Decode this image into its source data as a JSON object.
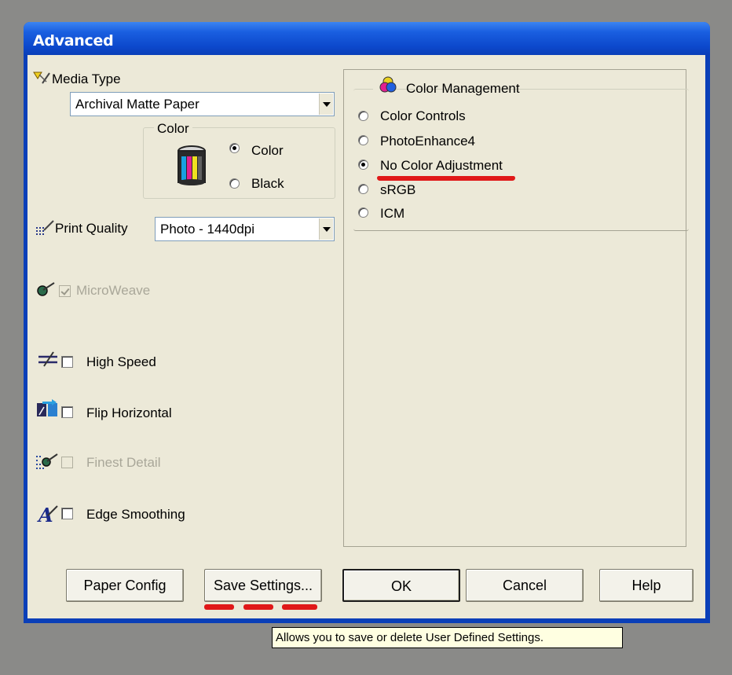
{
  "window": {
    "title": "Advanced"
  },
  "media_type": {
    "label": "Media Type",
    "selected": "Archival Matte Paper"
  },
  "color_group": {
    "label": "Color",
    "options": [
      {
        "label": "Color",
        "checked": true
      },
      {
        "label": "Black",
        "checked": false
      }
    ]
  },
  "print_quality": {
    "label": "Print Quality",
    "selected": "Photo - 1440dpi"
  },
  "options": {
    "microweave": {
      "label": "MicroWeave",
      "checked": true,
      "enabled": false
    },
    "high_speed": {
      "label": "High Speed",
      "checked": false,
      "enabled": true
    },
    "flip_horizontal": {
      "label": "Flip Horizontal",
      "checked": false,
      "enabled": true
    },
    "finest_detail": {
      "label": "Finest Detail",
      "checked": false,
      "enabled": false
    },
    "edge_smoothing": {
      "label": "Edge Smoothing",
      "checked": false,
      "enabled": true
    }
  },
  "color_management": {
    "label": "Color Management",
    "options": [
      {
        "label": "Color Controls",
        "checked": false
      },
      {
        "label": "PhotoEnhance4",
        "checked": false
      },
      {
        "label": "No Color Adjustment",
        "checked": true
      },
      {
        "label": "sRGB",
        "checked": false
      },
      {
        "label": "ICM",
        "checked": false
      }
    ]
  },
  "buttons": {
    "paper_config": "Paper Config",
    "save_settings": "Save Settings...",
    "ok": "OK",
    "cancel": "Cancel",
    "help": "Help"
  },
  "tooltip": "Allows you to save or delete User Defined Settings.",
  "colors": {
    "title_bar": "#0a3fb8",
    "dialog_bg": "#ece9d8",
    "annotation_red": "#e01818",
    "tooltip_bg": "#ffffe1"
  }
}
